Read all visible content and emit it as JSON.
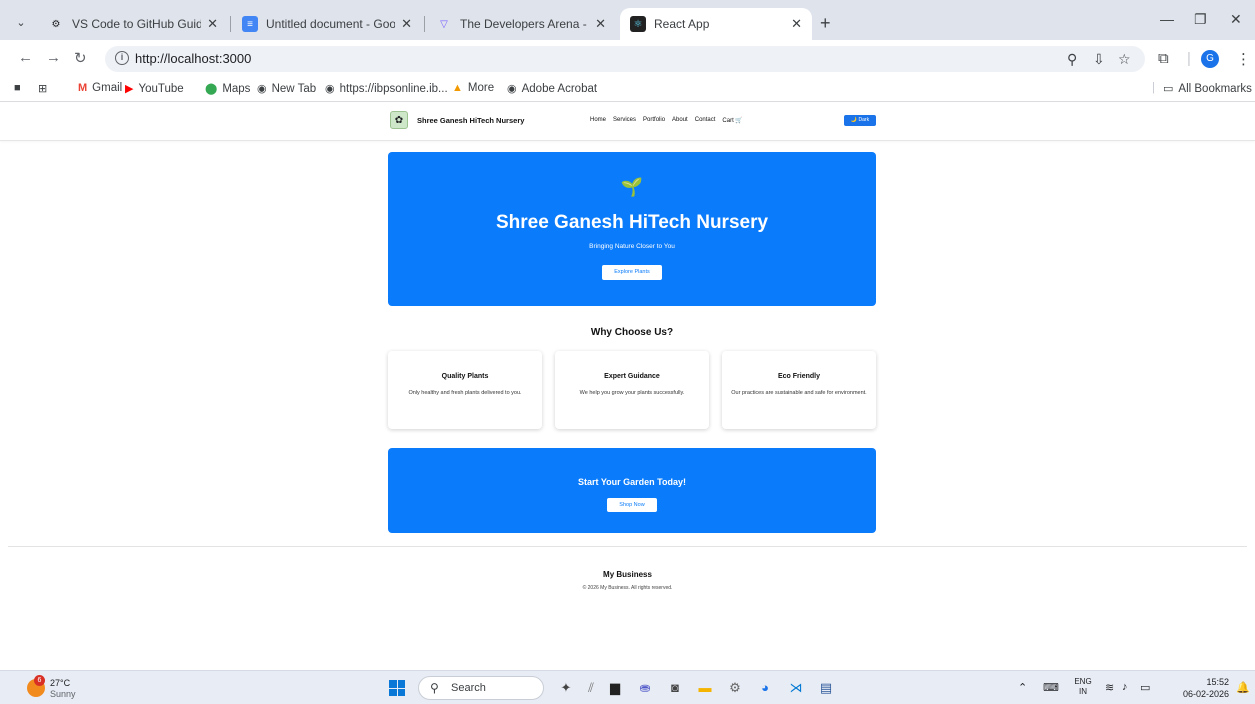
{
  "browser": {
    "tabs": [
      {
        "title": "VS Code to GitHub Guide",
        "icon": "openai-icon"
      },
      {
        "title": "Untitled document - Google Do",
        "icon": "google-docs-icon"
      },
      {
        "title": "The Developers Arena - Launch",
        "icon": "vite-icon"
      },
      {
        "title": "React App",
        "icon": "react-icon",
        "active": true
      }
    ],
    "url": "http://localhost:3000",
    "bookmarks": [
      "Gmail",
      "YouTube",
      "Maps",
      "New Tab",
      "https://ibpsonline.ib...",
      "More",
      "Adobe Acrobat"
    ],
    "all_bookmarks": "All Bookmarks",
    "profile_initial": "G"
  },
  "site": {
    "brand": "Shree Ganesh HiTech Nursery",
    "nav": [
      "Home",
      "Services",
      "Portfolio",
      "About",
      "Contact",
      "Cart 🛒"
    ],
    "theme_toggle": "🌙 Dark",
    "hero": {
      "title": "Shree Ganesh HiTech Nursery",
      "subtitle": "Bringing Nature Closer to You",
      "button": "Explore Plants"
    },
    "why": {
      "heading": "Why Choose Us?",
      "cards": [
        {
          "title": "Quality Plants",
          "text": "Only healthy and fresh plants delivered to you."
        },
        {
          "title": "Expert Guidance",
          "text": "We help you grow your plants successfully."
        },
        {
          "title": "Eco Friendly",
          "text": "Our practices are sustainable and safe for environment."
        }
      ]
    },
    "cta": {
      "title": "Start Your Garden Today!",
      "button": "Shop Now"
    },
    "footer": {
      "title": "My Business",
      "copyright": "© 2026 My Business. All rights reserved."
    }
  },
  "taskbar": {
    "weather_badge": "6",
    "temperature": "27°C",
    "condition": "Sunny",
    "search_placeholder": "Search",
    "language": "ENG",
    "region": "IN",
    "time": "15:52",
    "date": "06-02-2026"
  },
  "colors": {
    "accent": "#0a7bfa",
    "chrome": "#dfe3eb"
  }
}
